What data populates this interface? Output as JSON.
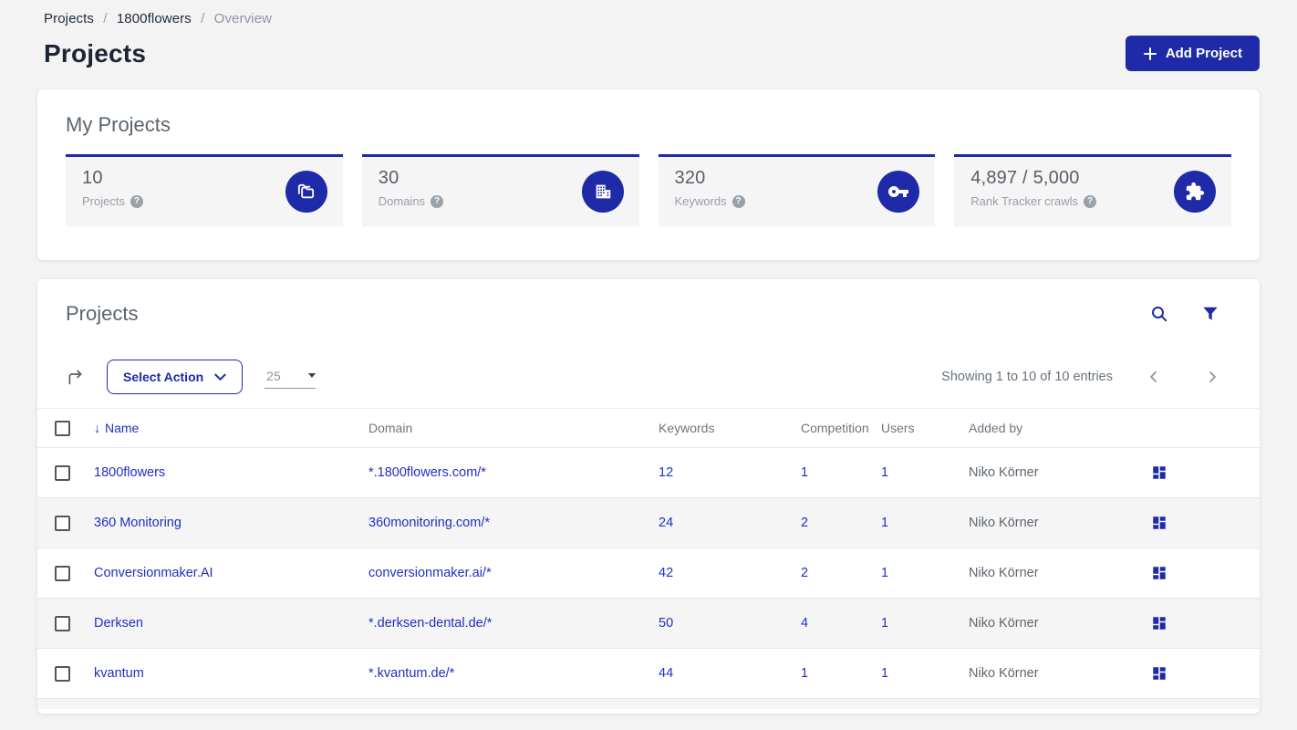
{
  "colors": {
    "primary": "#1e2aa7",
    "link": "#2030c0"
  },
  "breadcrumb": {
    "separator": "/",
    "items": [
      {
        "label": "Projects"
      },
      {
        "label": "1800flowers"
      },
      {
        "label": "Overview"
      }
    ]
  },
  "page": {
    "title": "Projects"
  },
  "header": {
    "add_project_label": "Add Project"
  },
  "my_projects": {
    "title": "My Projects",
    "stats": [
      {
        "value": "10",
        "label": "Projects",
        "icon": "projects-folders-icon"
      },
      {
        "value": "30",
        "label": "Domains",
        "icon": "domains-building-icon"
      },
      {
        "value": "320",
        "label": "Keywords",
        "icon": "keywords-key-icon"
      },
      {
        "value": "4,897 / 5,000",
        "label": "Rank Tracker crawls",
        "icon": "crawls-puzzle-icon"
      }
    ]
  },
  "projects_table": {
    "title": "Projects",
    "select_action_label": "Select Action",
    "page_size": "25",
    "showing_text": "Showing 1 to 10 of 10 entries",
    "columns": {
      "name": "Name",
      "domain": "Domain",
      "keywords": "Keywords",
      "competition": "Competition",
      "users": "Users",
      "added_by": "Added by"
    },
    "sort_arrow": "↓",
    "rows": [
      {
        "name": "1800flowers",
        "domain": "*.1800flowers.com/*",
        "keywords": "12",
        "competition": "1",
        "users": "1",
        "added_by": "Niko Körner"
      },
      {
        "name": "360 Monitoring",
        "domain": "360monitoring.com/*",
        "keywords": "24",
        "competition": "2",
        "users": "1",
        "added_by": "Niko Körner"
      },
      {
        "name": "Conversionmaker.AI",
        "domain": "conversionmaker.ai/*",
        "keywords": "42",
        "competition": "2",
        "users": "1",
        "added_by": "Niko Körner"
      },
      {
        "name": "Derksen",
        "domain": "*.derksen-dental.de/*",
        "keywords": "50",
        "competition": "4",
        "users": "1",
        "added_by": "Niko Körner"
      },
      {
        "name": "kvantum",
        "domain": "*.kvantum.de/*",
        "keywords": "44",
        "competition": "1",
        "users": "1",
        "added_by": "Niko Körner"
      }
    ],
    "help_glyph": "?"
  }
}
